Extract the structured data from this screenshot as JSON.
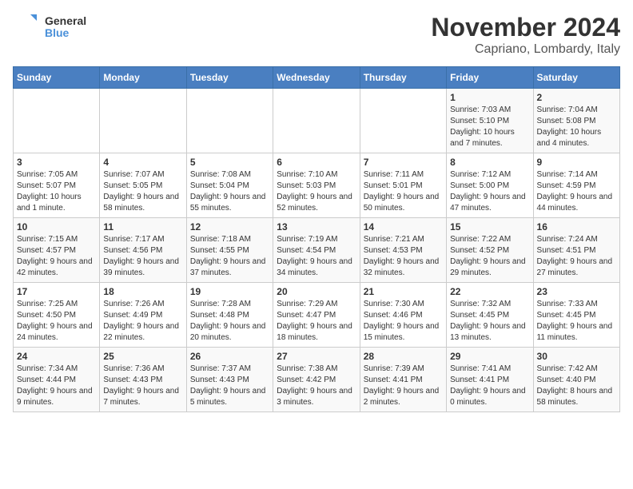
{
  "logo": {
    "general": "General",
    "blue": "Blue"
  },
  "title": "November 2024",
  "location": "Capriano, Lombardy, Italy",
  "headers": [
    "Sunday",
    "Monday",
    "Tuesday",
    "Wednesday",
    "Thursday",
    "Friday",
    "Saturday"
  ],
  "weeks": [
    [
      {
        "day": "",
        "info": ""
      },
      {
        "day": "",
        "info": ""
      },
      {
        "day": "",
        "info": ""
      },
      {
        "day": "",
        "info": ""
      },
      {
        "day": "",
        "info": ""
      },
      {
        "day": "1",
        "info": "Sunrise: 7:03 AM\nSunset: 5:10 PM\nDaylight: 10 hours and 7 minutes."
      },
      {
        "day": "2",
        "info": "Sunrise: 7:04 AM\nSunset: 5:08 PM\nDaylight: 10 hours and 4 minutes."
      }
    ],
    [
      {
        "day": "3",
        "info": "Sunrise: 7:05 AM\nSunset: 5:07 PM\nDaylight: 10 hours and 1 minute."
      },
      {
        "day": "4",
        "info": "Sunrise: 7:07 AM\nSunset: 5:05 PM\nDaylight: 9 hours and 58 minutes."
      },
      {
        "day": "5",
        "info": "Sunrise: 7:08 AM\nSunset: 5:04 PM\nDaylight: 9 hours and 55 minutes."
      },
      {
        "day": "6",
        "info": "Sunrise: 7:10 AM\nSunset: 5:03 PM\nDaylight: 9 hours and 52 minutes."
      },
      {
        "day": "7",
        "info": "Sunrise: 7:11 AM\nSunset: 5:01 PM\nDaylight: 9 hours and 50 minutes."
      },
      {
        "day": "8",
        "info": "Sunrise: 7:12 AM\nSunset: 5:00 PM\nDaylight: 9 hours and 47 minutes."
      },
      {
        "day": "9",
        "info": "Sunrise: 7:14 AM\nSunset: 4:59 PM\nDaylight: 9 hours and 44 minutes."
      }
    ],
    [
      {
        "day": "10",
        "info": "Sunrise: 7:15 AM\nSunset: 4:57 PM\nDaylight: 9 hours and 42 minutes."
      },
      {
        "day": "11",
        "info": "Sunrise: 7:17 AM\nSunset: 4:56 PM\nDaylight: 9 hours and 39 minutes."
      },
      {
        "day": "12",
        "info": "Sunrise: 7:18 AM\nSunset: 4:55 PM\nDaylight: 9 hours and 37 minutes."
      },
      {
        "day": "13",
        "info": "Sunrise: 7:19 AM\nSunset: 4:54 PM\nDaylight: 9 hours and 34 minutes."
      },
      {
        "day": "14",
        "info": "Sunrise: 7:21 AM\nSunset: 4:53 PM\nDaylight: 9 hours and 32 minutes."
      },
      {
        "day": "15",
        "info": "Sunrise: 7:22 AM\nSunset: 4:52 PM\nDaylight: 9 hours and 29 minutes."
      },
      {
        "day": "16",
        "info": "Sunrise: 7:24 AM\nSunset: 4:51 PM\nDaylight: 9 hours and 27 minutes."
      }
    ],
    [
      {
        "day": "17",
        "info": "Sunrise: 7:25 AM\nSunset: 4:50 PM\nDaylight: 9 hours and 24 minutes."
      },
      {
        "day": "18",
        "info": "Sunrise: 7:26 AM\nSunset: 4:49 PM\nDaylight: 9 hours and 22 minutes."
      },
      {
        "day": "19",
        "info": "Sunrise: 7:28 AM\nSunset: 4:48 PM\nDaylight: 9 hours and 20 minutes."
      },
      {
        "day": "20",
        "info": "Sunrise: 7:29 AM\nSunset: 4:47 PM\nDaylight: 9 hours and 18 minutes."
      },
      {
        "day": "21",
        "info": "Sunrise: 7:30 AM\nSunset: 4:46 PM\nDaylight: 9 hours and 15 minutes."
      },
      {
        "day": "22",
        "info": "Sunrise: 7:32 AM\nSunset: 4:45 PM\nDaylight: 9 hours and 13 minutes."
      },
      {
        "day": "23",
        "info": "Sunrise: 7:33 AM\nSunset: 4:45 PM\nDaylight: 9 hours and 11 minutes."
      }
    ],
    [
      {
        "day": "24",
        "info": "Sunrise: 7:34 AM\nSunset: 4:44 PM\nDaylight: 9 hours and 9 minutes."
      },
      {
        "day": "25",
        "info": "Sunrise: 7:36 AM\nSunset: 4:43 PM\nDaylight: 9 hours and 7 minutes."
      },
      {
        "day": "26",
        "info": "Sunrise: 7:37 AM\nSunset: 4:43 PM\nDaylight: 9 hours and 5 minutes."
      },
      {
        "day": "27",
        "info": "Sunrise: 7:38 AM\nSunset: 4:42 PM\nDaylight: 9 hours and 3 minutes."
      },
      {
        "day": "28",
        "info": "Sunrise: 7:39 AM\nSunset: 4:41 PM\nDaylight: 9 hours and 2 minutes."
      },
      {
        "day": "29",
        "info": "Sunrise: 7:41 AM\nSunset: 4:41 PM\nDaylight: 9 hours and 0 minutes."
      },
      {
        "day": "30",
        "info": "Sunrise: 7:42 AM\nSunset: 4:40 PM\nDaylight: 8 hours and 58 minutes."
      }
    ]
  ]
}
